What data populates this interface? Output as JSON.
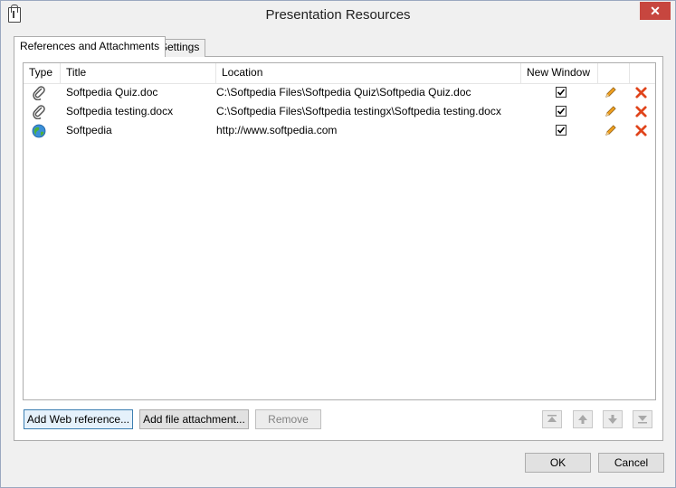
{
  "window": {
    "title": "Presentation Resources",
    "close_glyph": "✕"
  },
  "tabs": [
    {
      "label": "References and Attachments",
      "active": true
    },
    {
      "label": "Settings",
      "active": false
    }
  ],
  "list": {
    "columns": [
      "Type",
      "Title",
      "Location",
      "New Window"
    ],
    "rows": [
      {
        "type_icon": "paperclip-icon",
        "title": "Softpedia Quiz.doc",
        "location": "C:\\Softpedia Files\\Softpedia Quiz\\Softpedia Quiz.doc",
        "new_window": true
      },
      {
        "type_icon": "paperclip-icon",
        "title": "Softpedia testing.docx",
        "location": "C:\\Softpedia Files\\Softpedia testingx\\Softpedia testing.docx",
        "new_window": true
      },
      {
        "type_icon": "globe-icon",
        "title": "Softpedia",
        "location": "http://www.softpedia.com",
        "new_window": true
      }
    ]
  },
  "buttons": {
    "add_web_reference": "Add Web reference...",
    "add_file_attachment": "Add file attachment...",
    "remove": "Remove",
    "ok": "OK",
    "cancel": "Cancel"
  },
  "colors": {
    "close": "#c7463f",
    "delete": "#e0441b",
    "edit": "#f0a020",
    "focus": "#3c7fb1"
  }
}
